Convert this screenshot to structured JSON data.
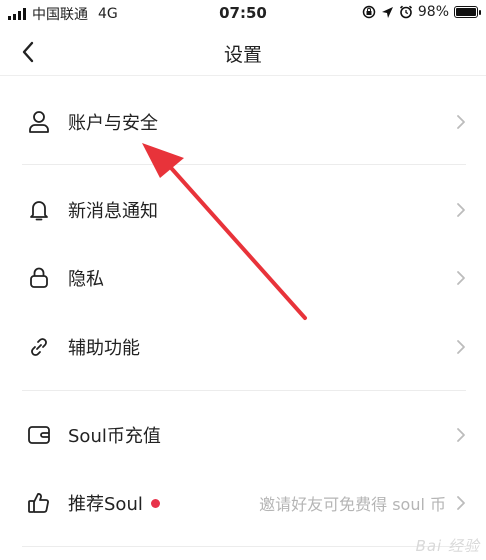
{
  "status_bar": {
    "carrier": "中国联通",
    "network": "4G",
    "time": "07:50",
    "battery": "98%",
    "battery_level": 0.98
  },
  "header": {
    "title": "设置"
  },
  "settings": {
    "items": [
      {
        "label": "账户与安全",
        "icon": "person-icon"
      },
      {
        "label": "新消息通知",
        "icon": "bell-icon"
      },
      {
        "label": "隐私",
        "icon": "lock-icon"
      },
      {
        "label": "辅助功能",
        "icon": "link-icon"
      },
      {
        "label": "Soul币充值",
        "icon": "wallet-icon"
      },
      {
        "label": "推荐Soul",
        "icon": "thumbs-up-icon",
        "subtitle": "邀请好友可免费得 soul 币",
        "badge_color": "#e8324a"
      }
    ]
  },
  "annotation": {
    "arrow_color": "#e8333a"
  },
  "watermark": "Bai 经验"
}
